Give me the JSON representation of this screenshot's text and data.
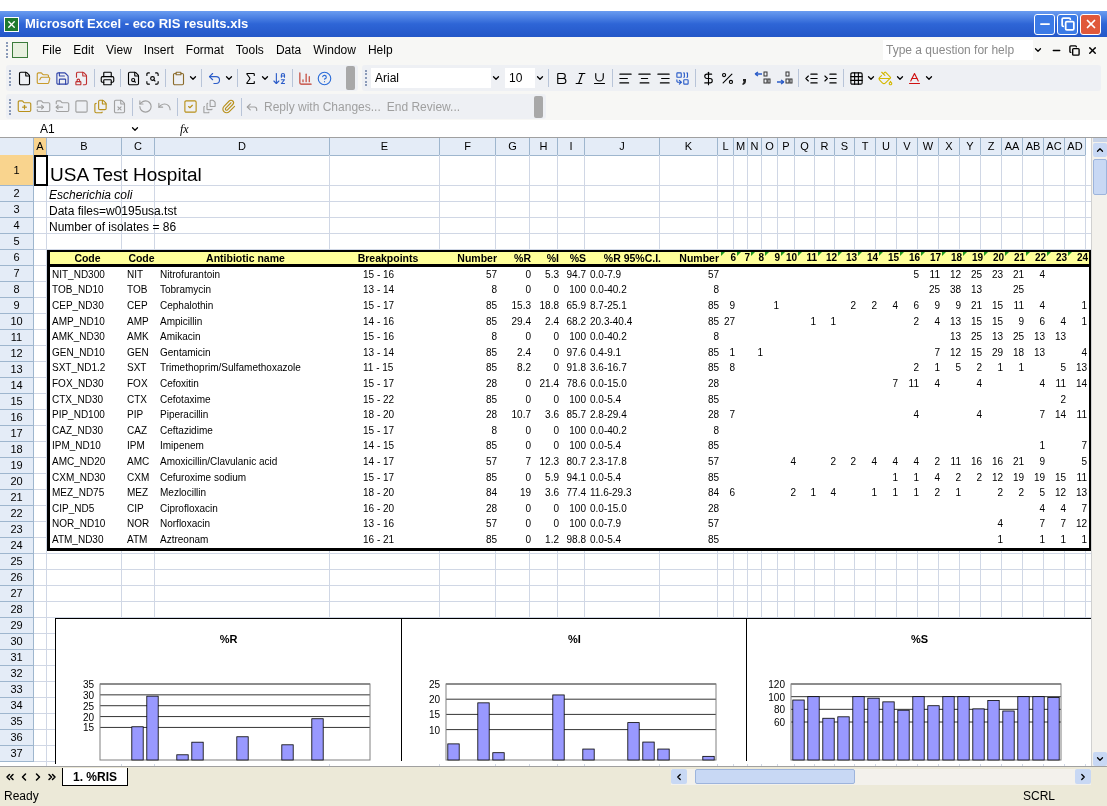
{
  "window": {
    "title": "Microsoft Excel - eco RIS results.xls"
  },
  "menu_bar": [
    "File",
    "Edit",
    "View",
    "Insert",
    "Format",
    "Tools",
    "Data",
    "Window",
    "Help"
  ],
  "help_box": {
    "placeholder": "Type a question for help"
  },
  "formatting_toolbar": {
    "font": "Arial",
    "size": "10"
  },
  "reviewing_toolbar": [
    {
      "label": "Reply with Changes...",
      "disabled": true
    },
    {
      "label": "End Review...",
      "disabled": true
    }
  ],
  "formula_bar": {
    "name_box": "A1",
    "function_label": "fx"
  },
  "column_headers": [
    {
      "label": "A",
      "selected": true
    },
    {
      "label": "B",
      "selected": false
    },
    {
      "label": "C",
      "selected": false
    },
    {
      "label": "D",
      "selected": false
    },
    {
      "label": "E",
      "selected": false
    },
    {
      "label": "F",
      "selected": false
    },
    {
      "label": "G",
      "selected": false
    },
    {
      "label": "H",
      "selected": false
    },
    {
      "label": "I",
      "selected": false
    },
    {
      "label": "J",
      "selected": false
    },
    {
      "label": "K",
      "selected": false
    },
    {
      "label": "L",
      "selected": false
    },
    {
      "label": "M",
      "selected": false
    },
    {
      "label": "N",
      "selected": false
    },
    {
      "label": "O",
      "selected": false
    },
    {
      "label": "P",
      "selected": false
    },
    {
      "label": "Q",
      "selected": false
    },
    {
      "label": "R",
      "selected": false
    },
    {
      "label": "S",
      "selected": false
    },
    {
      "label": "T",
      "selected": false
    },
    {
      "label": "U",
      "selected": false
    },
    {
      "label": "V",
      "selected": false
    },
    {
      "label": "W",
      "selected": false
    },
    {
      "label": "X",
      "selected": false
    },
    {
      "label": "Y",
      "selected": false
    },
    {
      "label": "Z",
      "selected": false
    },
    {
      "label": "AA",
      "selected": false
    },
    {
      "label": "AB",
      "selected": false
    },
    {
      "label": "AC",
      "selected": false
    },
    {
      "label": "AD",
      "selected": false
    }
  ],
  "row_headers": [
    {
      "label": "1",
      "selected": true
    },
    {
      "label": "2",
      "selected": false
    },
    {
      "label": "3",
      "selected": false
    },
    {
      "label": "4",
      "selected": false
    },
    {
      "label": "5",
      "selected": false
    },
    {
      "label": "6",
      "selected": false
    },
    {
      "label": "7",
      "selected": false
    },
    {
      "label": "8",
      "selected": false
    },
    {
      "label": "9",
      "selected": false
    },
    {
      "label": "10",
      "selected": false
    },
    {
      "label": "11",
      "selected": false
    },
    {
      "label": "12",
      "selected": false
    },
    {
      "label": "13",
      "selected": false
    },
    {
      "label": "14",
      "selected": false
    },
    {
      "label": "15",
      "selected": false
    },
    {
      "label": "16",
      "selected": false
    },
    {
      "label": "17",
      "selected": false
    },
    {
      "label": "18",
      "selected": false
    },
    {
      "label": "19",
      "selected": false
    },
    {
      "label": "20",
      "selected": false
    },
    {
      "label": "21",
      "selected": false
    },
    {
      "label": "22",
      "selected": false
    },
    {
      "label": "23",
      "selected": false
    },
    {
      "label": "24",
      "selected": false
    },
    {
      "label": "25",
      "selected": false
    },
    {
      "label": "26",
      "selected": false
    },
    {
      "label": "27",
      "selected": false
    },
    {
      "label": "28",
      "selected": false
    },
    {
      "label": "29",
      "selected": false
    },
    {
      "label": "30",
      "selected": false
    },
    {
      "label": "31",
      "selected": false
    },
    {
      "label": "32",
      "selected": false
    },
    {
      "label": "33",
      "selected": false
    },
    {
      "label": "34",
      "selected": false
    },
    {
      "label": "35",
      "selected": false
    },
    {
      "label": "36",
      "selected": false
    },
    {
      "label": "37",
      "selected": false
    }
  ],
  "sheet": {
    "title": "USA Test Hospital",
    "organism": "Escherichia coli",
    "info": [
      "Data files=w0195usa.tst",
      "Number of isolates = 86"
    ]
  },
  "table": {
    "columns": [
      "Code",
      "Code",
      "Antibiotic name",
      "Breakpoints",
      "Number",
      "%R",
      "%I",
      "%S",
      "%R 95%C.I.",
      "Number",
      "6",
      "7",
      "8",
      "9",
      "10",
      "11",
      "12",
      "13",
      "14",
      "15",
      "16",
      "17",
      "18",
      "19",
      "20",
      "21",
      "22",
      "23",
      "24"
    ],
    "rows": [
      {
        "code": "NIT_ND300",
        "abbr": "NIT",
        "name": "Nitrofurantoin",
        "breakpoints": "15 - 16",
        "number": "57",
        "pct_r": "0",
        "pct_i": "5.3",
        "pct_s": "94.7",
        "ci": "0.0-7.9",
        "tested": "57",
        "counts": {
          "col_16": "5",
          "col_17": "11",
          "col_18": "12",
          "col_19": "25",
          "col_20": "23",
          "col_21": "21",
          "col_22": "4"
        }
      },
      {
        "code": "TOB_ND10",
        "abbr": "TOB",
        "name": "Tobramycin",
        "breakpoints": "13 - 14",
        "number": "8",
        "pct_r": "0",
        "pct_i": "0",
        "pct_s": "100",
        "ci": "0.0-40.2",
        "tested": "8",
        "counts": {
          "col_17": "25",
          "col_18": "38",
          "col_19": "13",
          "col_21": "25"
        }
      },
      {
        "code": "CEP_ND30",
        "abbr": "CEP",
        "name": "Cephalothin",
        "breakpoints": "15 - 17",
        "number": "85",
        "pct_r": "15.3",
        "pct_i": "18.8",
        "pct_s": "65.9",
        "ci": "8.7-25.1",
        "tested": "85",
        "counts": {
          "col_6": "9",
          "col_9": "1",
          "col_13": "2",
          "col_14": "2",
          "col_15": "4",
          "col_16": "6",
          "col_17": "9",
          "col_18": "9",
          "col_19": "21",
          "col_20": "15",
          "col_21": "11",
          "col_22": "4",
          "col_24": "1"
        }
      },
      {
        "code": "AMP_ND10",
        "abbr": "AMP",
        "name": "Ampicillin",
        "breakpoints": "14 - 16",
        "number": "85",
        "pct_r": "29.4",
        "pct_i": "2.4",
        "pct_s": "68.2",
        "ci": "20.3-40.4",
        "tested": "85",
        "counts": {
          "col_6": "27",
          "col_11": "1",
          "col_12": "1",
          "col_16": "2",
          "col_17": "4",
          "col_18": "13",
          "col_19": "15",
          "col_20": "15",
          "col_21": "9",
          "col_22": "6",
          "col_23": "4",
          "col_24": "1"
        }
      },
      {
        "code": "AMK_ND30",
        "abbr": "AMK",
        "name": "Amikacin",
        "breakpoints": "15 - 16",
        "number": "8",
        "pct_r": "0",
        "pct_i": "0",
        "pct_s": "100",
        "ci": "0.0-40.2",
        "tested": "8",
        "counts": {
          "col_18": "13",
          "col_19": "25",
          "col_20": "13",
          "col_21": "25",
          "col_22": "13",
          "col_23": "13"
        }
      },
      {
        "code": "GEN_ND10",
        "abbr": "GEN",
        "name": "Gentamicin",
        "breakpoints": "13 - 14",
        "number": "85",
        "pct_r": "2.4",
        "pct_i": "0",
        "pct_s": "97.6",
        "ci": "0.4-9.1",
        "tested": "85",
        "counts": {
          "col_6": "1",
          "col_8": "1",
          "col_17": "7",
          "col_18": "12",
          "col_19": "15",
          "col_20": "29",
          "col_21": "18",
          "col_22": "13",
          "col_24": "4"
        }
      },
      {
        "code": "SXT_ND1.2",
        "abbr": "SXT",
        "name": "Trimethoprim/Sulfamethoxazole",
        "breakpoints": "11 - 15",
        "number": "85",
        "pct_r": "8.2",
        "pct_i": "0",
        "pct_s": "91.8",
        "ci": "3.6-16.7",
        "tested": "85",
        "counts": {
          "col_6": "8",
          "col_16": "2",
          "col_17": "1",
          "col_18": "5",
          "col_19": "2",
          "col_20": "1",
          "col_21": "1",
          "col_23": "5",
          "col_24": "13"
        }
      },
      {
        "code": "FOX_ND30",
        "abbr": "FOX",
        "name": "Cefoxitin",
        "breakpoints": "15 - 17",
        "number": "28",
        "pct_r": "0",
        "pct_i": "21.4",
        "pct_s": "78.6",
        "ci": "0.0-15.0",
        "tested": "28",
        "counts": {
          "col_15": "7",
          "col_16": "11",
          "col_17": "4",
          "col_19": "4",
          "col_22": "4",
          "col_23": "11",
          "col_24": "14"
        }
      },
      {
        "code": "CTX_ND30",
        "abbr": "CTX",
        "name": "Cefotaxime",
        "breakpoints": "15 - 22",
        "number": "85",
        "pct_r": "0",
        "pct_i": "0",
        "pct_s": "100",
        "ci": "0.0-5.4",
        "tested": "85",
        "counts": {
          "col_23": "2"
        }
      },
      {
        "code": "PIP_ND100",
        "abbr": "PIP",
        "name": "Piperacillin",
        "breakpoints": "18 - 20",
        "number": "28",
        "pct_r": "10.7",
        "pct_i": "3.6",
        "pct_s": "85.7",
        "ci": "2.8-29.4",
        "tested": "28",
        "counts": {
          "col_6": "7",
          "col_16": "4",
          "col_19": "4",
          "col_22": "7",
          "col_23": "14",
          "col_24": "11"
        }
      },
      {
        "code": "CAZ_ND30",
        "abbr": "CAZ",
        "name": "Ceftazidime",
        "breakpoints": "15 - 17",
        "number": "8",
        "pct_r": "0",
        "pct_i": "0",
        "pct_s": "100",
        "ci": "0.0-40.2",
        "tested": "8"
      },
      {
        "code": "IPM_ND10",
        "abbr": "IPM",
        "name": "Imipenem",
        "breakpoints": "14 - 15",
        "number": "85",
        "pct_r": "0",
        "pct_i": "0",
        "pct_s": "100",
        "ci": "0.0-5.4",
        "tested": "85",
        "counts": {
          "col_22": "1",
          "col_24": "7"
        }
      },
      {
        "code": "AMC_ND20",
        "abbr": "AMC",
        "name": "Amoxicillin/Clavulanic acid",
        "breakpoints": "14 - 17",
        "number": "57",
        "pct_r": "7",
        "pct_i": "12.3",
        "pct_s": "80.7",
        "ci": "2.3-17.8",
        "tested": "57",
        "counts": {
          "col_10": "4",
          "col_12": "2",
          "col_13": "2",
          "col_14": "4",
          "col_15": "4",
          "col_16": "4",
          "col_17": "2",
          "col_18": "11",
          "col_19": "16",
          "col_20": "16",
          "col_21": "21",
          "col_22": "9",
          "col_24": "5"
        }
      },
      {
        "code": "CXM_ND30",
        "abbr": "CXM",
        "name": "Cefuroxime sodium",
        "breakpoints": "15 - 17",
        "number": "85",
        "pct_r": "0",
        "pct_i": "5.9",
        "pct_s": "94.1",
        "ci": "0.0-5.4",
        "tested": "85",
        "counts": {
          "col_15": "1",
          "col_16": "1",
          "col_17": "4",
          "col_18": "2",
          "col_19": "2",
          "col_20": "12",
          "col_21": "19",
          "col_22": "19",
          "col_23": "15",
          "col_24": "11"
        }
      },
      {
        "code": "MEZ_ND75",
        "abbr": "MEZ",
        "name": "Mezlocillin",
        "breakpoints": "18 - 20",
        "number": "84",
        "pct_r": "19",
        "pct_i": "3.6",
        "pct_s": "77.4",
        "ci": "11.6-29.3",
        "tested": "84",
        "counts": {
          "col_6": "6",
          "col_10": "2",
          "col_11": "1",
          "col_12": "4",
          "col_14": "1",
          "col_15": "1",
          "col_16": "1",
          "col_17": "2",
          "col_18": "1",
          "col_20": "2",
          "col_21": "2",
          "col_22": "5",
          "col_23": "12",
          "col_24": "13"
        }
      },
      {
        "code": "CIP_ND5",
        "abbr": "CIP",
        "name": "Ciprofloxacin",
        "breakpoints": "16 - 20",
        "number": "28",
        "pct_r": "0",
        "pct_i": "0",
        "pct_s": "100",
        "ci": "0.0-15.0",
        "tested": "28",
        "counts": {
          "col_22": "4",
          "col_23": "4",
          "col_24": "7"
        }
      },
      {
        "code": "NOR_ND10",
        "abbr": "NOR",
        "name": "Norfloxacin",
        "breakpoints": "13 - 16",
        "number": "57",
        "pct_r": "0",
        "pct_i": "0",
        "pct_s": "100",
        "ci": "0.0-7.9",
        "tested": "57",
        "counts": {
          "col_20": "4",
          "col_22": "7",
          "col_23": "7",
          "col_24": "12"
        }
      },
      {
        "code": "ATM_ND30",
        "abbr": "ATM",
        "name": "Aztreonam",
        "breakpoints": "16 - 21",
        "number": "85",
        "pct_r": "0",
        "pct_i": "1.2",
        "pct_s": "98.8",
        "ci": "0.0-5.4",
        "tested": "85",
        "counts": {
          "col_20": "1",
          "col_22": "1",
          "col_23": "1",
          "col_24": "1"
        }
      }
    ]
  },
  "charts": [
    {
      "chart_data": {
        "type": "bar",
        "title": "%R",
        "values": [
          0,
          0,
          15.3,
          29.4,
          0,
          2.4,
          8.2,
          0,
          0,
          10.7,
          0,
          0,
          7,
          0,
          19,
          0,
          0,
          0
        ],
        "ylim": [
          0,
          35
        ],
        "yticks": [
          15,
          20,
          25,
          30,
          35
        ],
        "grid": true
      }
    },
    {
      "chart_data": {
        "type": "bar",
        "title": "%I",
        "values": [
          5.3,
          0,
          18.8,
          2.4,
          0,
          0,
          0,
          21.4,
          0,
          3.6,
          0,
          0,
          12.3,
          5.9,
          3.6,
          0,
          0,
          1.2
        ],
        "ylim": [
          0,
          25
        ],
        "yticks": [
          10,
          15,
          20,
          25
        ],
        "grid": true
      }
    },
    {
      "chart_data": {
        "type": "bar",
        "title": "%S",
        "values": [
          94.7,
          100,
          65.9,
          68.2,
          100,
          97.6,
          91.8,
          78.6,
          100,
          85.7,
          100,
          100,
          80.7,
          94.1,
          77.4,
          100,
          100,
          98.8
        ],
        "ylim": [
          0,
          120
        ],
        "yticks": [
          60,
          80,
          100,
          120
        ],
        "grid": true
      }
    }
  ],
  "sheet_tabs": [
    {
      "label": "1. %RIS",
      "selected": true
    }
  ],
  "status_bar": {
    "status": "Ready",
    "indicator": "SCRL"
  }
}
